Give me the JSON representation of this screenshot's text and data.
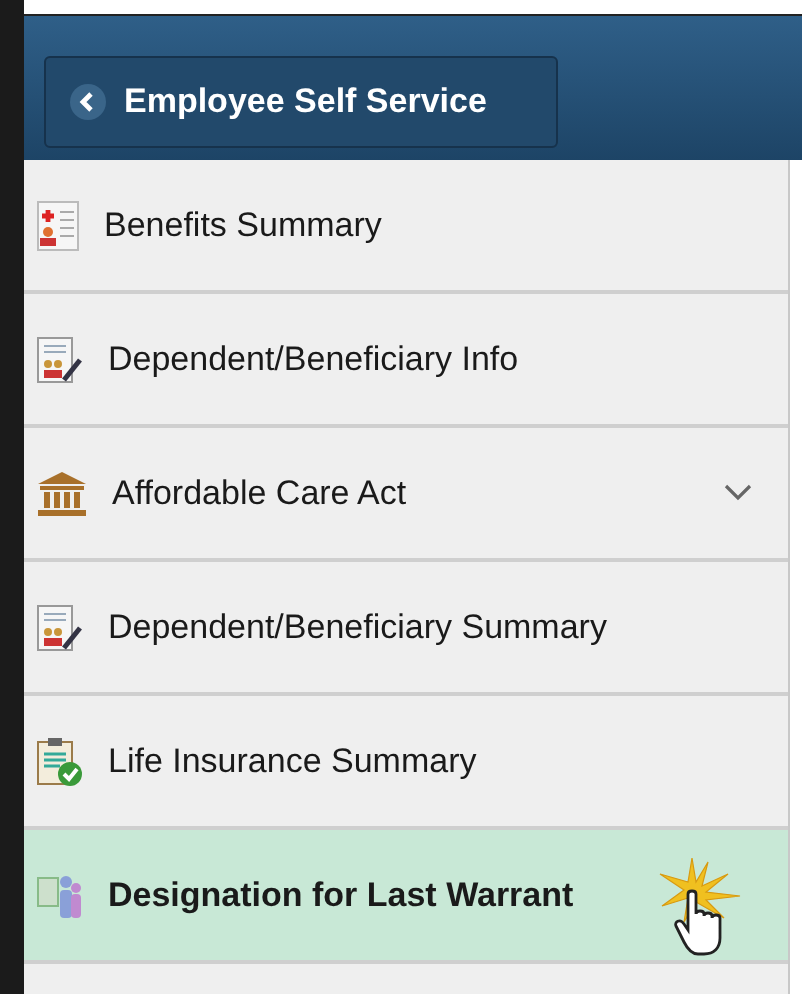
{
  "header": {
    "back_button": "Employee Self Service"
  },
  "menu_items": [
    {
      "label": "Benefits Summary",
      "selected": false
    },
    {
      "label": "Dependent/Beneficiary Info",
      "selected": false
    },
    {
      "label": "Affordable Care Act",
      "selected": false,
      "expanded": false
    },
    {
      "label": "Dependent/Beneficiary Summary",
      "selected": false
    },
    {
      "label": "Life Insurance Summary",
      "selected": false
    },
    {
      "label": "Designation for Last Warrant",
      "selected": true
    }
  ]
}
